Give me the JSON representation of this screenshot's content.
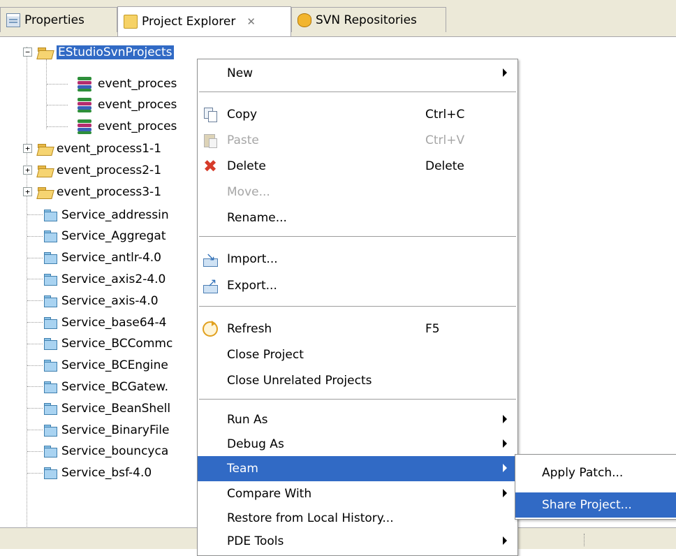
{
  "tabs": [
    {
      "label": "Properties",
      "icon": "properties-icon"
    },
    {
      "label": "Project Explorer",
      "icon": "folder-icon",
      "close": "✕"
    },
    {
      "label": "SVN Repositories",
      "icon": "svn-repository-icon"
    }
  ],
  "tree": {
    "root": {
      "label": "EStudioSvnProjects",
      "toggle": "−"
    },
    "children": [
      "event_proces",
      "event_proces",
      "event_proces"
    ],
    "projects": [
      {
        "label": "event_process1-1",
        "toggle": "+"
      },
      {
        "label": "event_process2-1",
        "toggle": "+"
      },
      {
        "label": "event_process3-1",
        "toggle": "+"
      }
    ],
    "services": [
      "Service_addressin",
      "Service_Aggregat",
      "Service_antlr-4.0",
      "Service_axis2-4.0",
      "Service_axis-4.0",
      "Service_base64-4",
      "Service_BCCommc",
      "Service_BCEngine",
      "Service_BCGatew.",
      "Service_BeanShell",
      "Service_BinaryFile",
      "Service_bouncyca",
      "Service_bsf-4.0"
    ]
  },
  "context_menu": {
    "new": "New",
    "copy": "Copy",
    "copy_shortcut": "Ctrl+C",
    "paste": "Paste",
    "paste_shortcut": "Ctrl+V",
    "delete": "Delete",
    "delete_shortcut": "Delete",
    "move": "Move...",
    "rename": "Rename...",
    "import": "Import...",
    "export": "Export...",
    "refresh": "Refresh",
    "refresh_shortcut": "F5",
    "close_project": "Close Project",
    "close_unrelated": "Close Unrelated Projects",
    "run_as": "Run As",
    "debug_as": "Debug As",
    "team": "Team",
    "compare_with": "Compare With",
    "restore": "Restore from Local History...",
    "pde_tools": "PDE Tools"
  },
  "submenu": {
    "apply_patch": "Apply Patch...",
    "share_project": "Share Project..."
  },
  "colors": {
    "selection": "#316ac5",
    "chrome": "#ece9d8"
  }
}
